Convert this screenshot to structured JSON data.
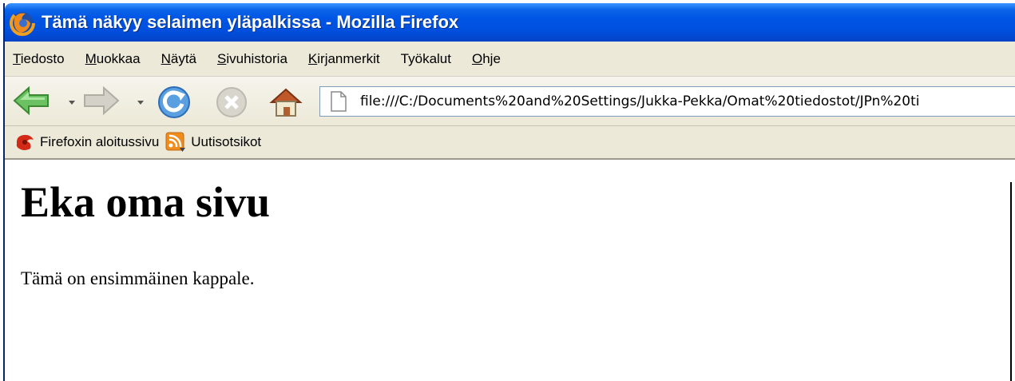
{
  "window": {
    "title": "Tämä näkyy selaimen yläpalkissa - Mozilla Firefox"
  },
  "menubar": {
    "items": [
      {
        "underline": "T",
        "rest": "iedosto"
      },
      {
        "underline": "M",
        "rest": "uokkaa"
      },
      {
        "underline": "N",
        "rest": "äytä"
      },
      {
        "underline": "S",
        "rest": "ivuhistoria"
      },
      {
        "underline": "K",
        "rest": "irjanmerkit"
      },
      {
        "underline": "T",
        "rest": "yökalut",
        "prefix": ""
      },
      {
        "underline": "O",
        "rest": "hje"
      }
    ]
  },
  "navbar": {
    "icons": [
      "back-arrow-icon",
      "forward-arrow-icon",
      "reload-icon",
      "stop-icon",
      "home-icon"
    ],
    "url": "file:///C:/Documents%20and%20Settings/Jukka-Pekka/Omat%20tiedostot/JPn%20ti"
  },
  "bookmarks": {
    "items": [
      {
        "label": "Firefoxin aloitussivu",
        "icon": "firefox-bookmark-icon"
      },
      {
        "label": "Uutisotsikot",
        "icon": "rss-feed-icon"
      }
    ]
  },
  "page": {
    "heading": "Eka oma sivu",
    "paragraph": "Tämä on ensimmäinen kappale."
  },
  "colors": {
    "titlebar": "#0055e5",
    "chrome": "#ece9d8",
    "accent_green": "#4fb04a"
  }
}
